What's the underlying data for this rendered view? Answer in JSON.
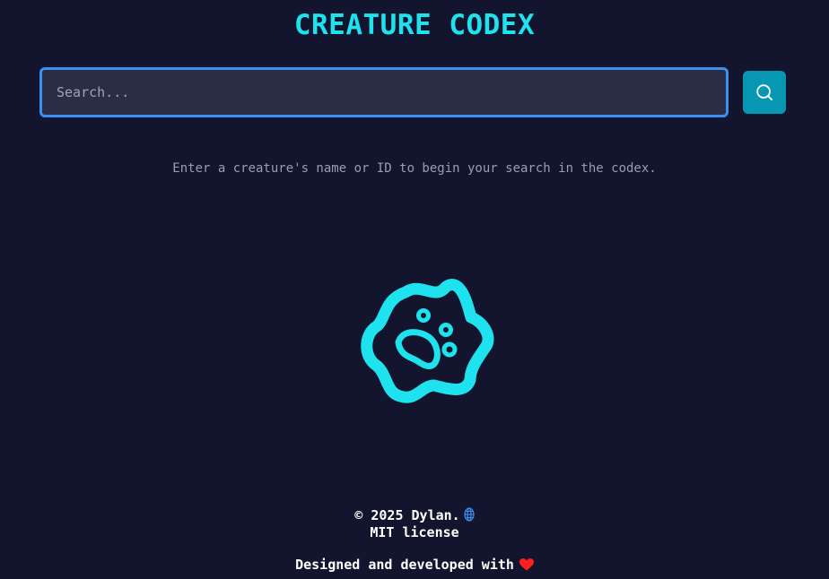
{
  "header": {
    "title": "CREATURE CODEX"
  },
  "search": {
    "placeholder": "Search...",
    "value": "",
    "button_icon": "search-icon"
  },
  "hint": {
    "text": "Enter a creature's name or ID to begin your search in the codex."
  },
  "illustration": {
    "icon": "amoeba-icon",
    "color": "#1ee3ee"
  },
  "footer": {
    "copyright": "© 2025 Dylan.",
    "copyright_icon": "globe-icon",
    "license": "MIT license",
    "credit": "Designed and developed with",
    "credit_icon": "heart-icon"
  },
  "colors": {
    "background": "#12152d",
    "accent": "#1ee3ee",
    "input_border": "#3c8ff1",
    "button": "#0897b2",
    "heart": "#ff1f1f"
  }
}
